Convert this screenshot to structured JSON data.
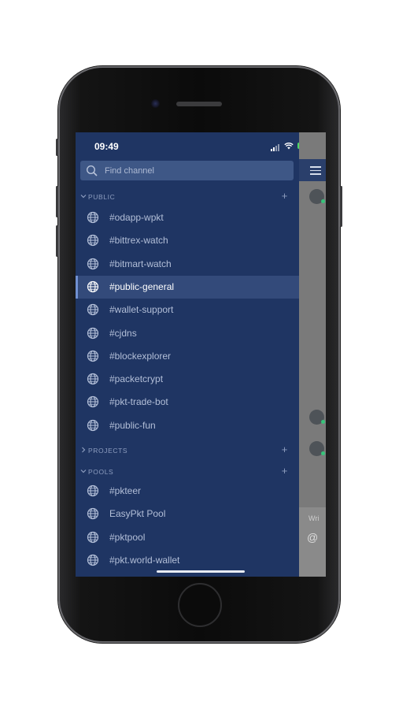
{
  "status_bar": {
    "time": "09:49"
  },
  "search": {
    "placeholder": "Find channel"
  },
  "sections": {
    "public": {
      "label": "PUBLIC",
      "add": "+"
    },
    "projects": {
      "label": "PROJECTS",
      "add": "+"
    },
    "pools": {
      "label": "POOLS",
      "add": "+"
    }
  },
  "public_channels": [
    "#odapp-wpkt",
    "#bittrex-watch",
    "#bitmart-watch",
    "#public-general",
    "#wallet-support",
    "#cjdns",
    "#blockexplorer",
    "#packetcrypt",
    "#pkt-trade-bot",
    "#public-fun"
  ],
  "active_channel": "#public-general",
  "pool_channels": [
    "#pkteer",
    "EasyPkt Pool",
    "#pktpool",
    "#pkt.world-wallet"
  ],
  "peek": {
    "write_placeholder": "Wri",
    "at_icon": "@"
  },
  "icons": [
    "search-icon",
    "globe-icon",
    "chevron-down-icon",
    "chevron-right-icon",
    "menu-icon",
    "wifi-icon",
    "battery-icon"
  ],
  "colors": {
    "drawer_bg": "#1f3563",
    "active_bg": "#334a7a",
    "search_bg": "#3e5786",
    "online": "#37c37a"
  }
}
